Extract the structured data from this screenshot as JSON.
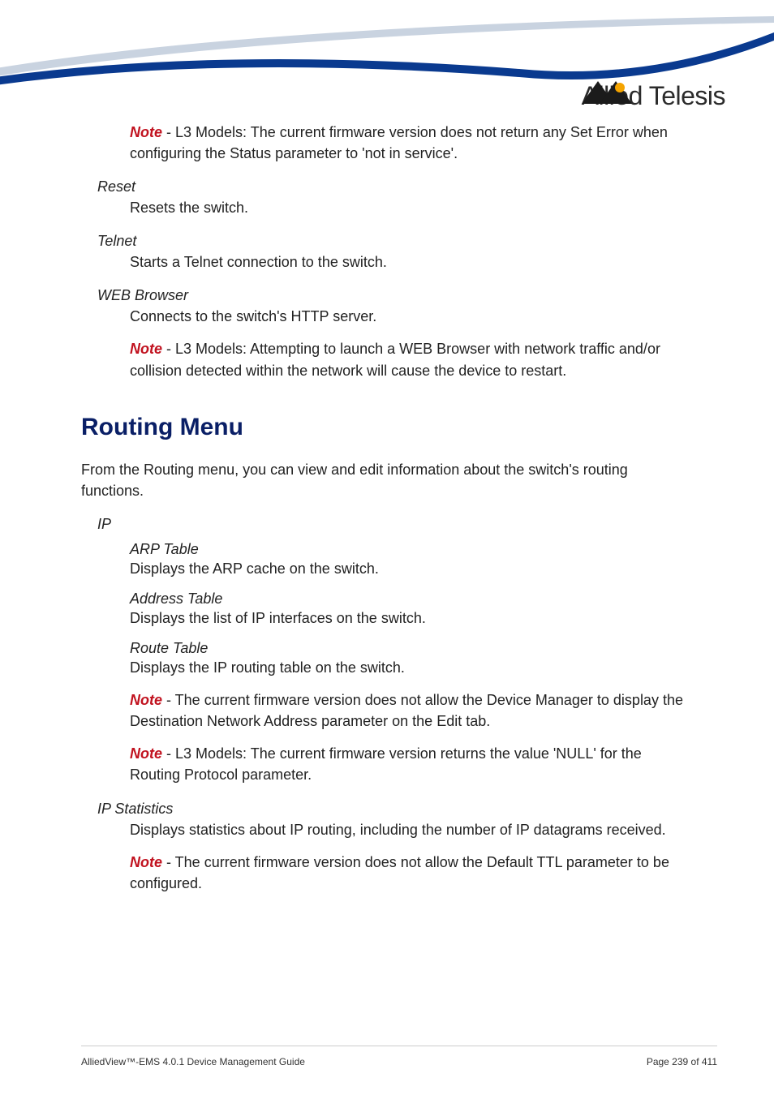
{
  "logo": {
    "text": "Allied Telesis"
  },
  "top_note": {
    "prefix": "Note",
    "body": " - L3 Models: The current firmware version does not return any Set Error when configuring the Status parameter to 'not in service'."
  },
  "defs": {
    "reset": {
      "term": "Reset",
      "body": "Resets the switch."
    },
    "telnet": {
      "term": "Telnet",
      "body": "Starts a Telnet connection to the switch."
    },
    "web": {
      "term": "WEB Browser",
      "body": "Connects to the switch's HTTP server.",
      "note_prefix": "Note",
      "note_body": " - L3 Models: Attempting to launch a WEB Browser with network traffic and/or collision detected within the network will cause the device to restart."
    }
  },
  "section": {
    "heading": "Routing Menu",
    "intro": "From the Routing menu, you can view and edit information about the switch's routing functions."
  },
  "ip": {
    "term": "IP",
    "arp": {
      "title": "ARP Table",
      "body": "Displays the ARP cache on the switch."
    },
    "addr": {
      "title": "Address Table",
      "body": "Displays the list of IP interfaces on the switch."
    },
    "route": {
      "title": "Route Table",
      "body": "Displays the IP routing table on the switch."
    },
    "note1_prefix": "Note",
    "note1_body": " - The current firmware version does not allow the Device Manager to display the Destination Network Address parameter on the Edit tab.",
    "note2_prefix": "Note",
    "note2_body": " - L3 Models: The current firmware version returns the value 'NULL' for the Routing Protocol parameter."
  },
  "ipstats": {
    "term": "IP Statistics",
    "body": "Displays statistics about IP routing, including the number of IP datagrams received.",
    "note_prefix": "Note",
    "note_body": " - The current firmware version does not allow the Default TTL parameter to be configured."
  },
  "footer": {
    "left": "AlliedView™-EMS 4.0.1 Device Management Guide",
    "right": "Page 239 of 411"
  }
}
